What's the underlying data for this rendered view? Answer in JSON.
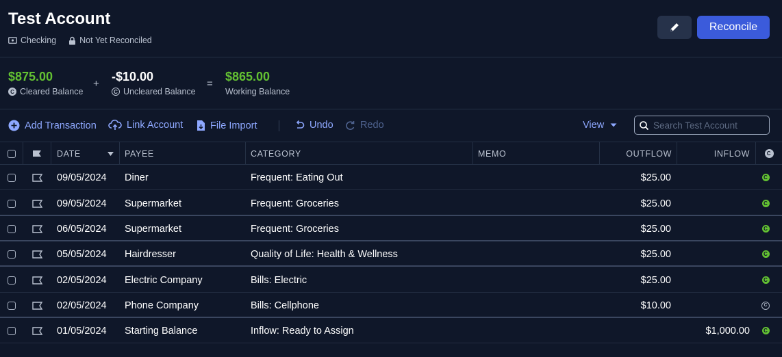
{
  "account": {
    "title": "Test Account",
    "type_label": "Checking",
    "reconcile_status": "Not Yet Reconciled",
    "reconcile_button": "Reconcile"
  },
  "balances": {
    "cleared": {
      "amount": "$875.00",
      "label": "Cleared Balance"
    },
    "plus": "+",
    "uncleared": {
      "amount": "-$10.00",
      "label": "Uncleared Balance"
    },
    "equals": "=",
    "working": {
      "amount": "$865.00",
      "label": "Working Balance"
    }
  },
  "toolbar": {
    "add_transaction": "Add Transaction",
    "link_account": "Link Account",
    "file_import": "File Import",
    "undo": "Undo",
    "redo": "Redo",
    "view": "View",
    "search_placeholder": "Search Test Account"
  },
  "columns": {
    "date": "DATE",
    "payee": "PAYEE",
    "category": "CATEGORY",
    "memo": "MEMO",
    "outflow": "OUTFLOW",
    "inflow": "INFLOW"
  },
  "transactions": [
    {
      "date": "09/05/2024",
      "payee": "Diner",
      "category": "Frequent: Eating Out",
      "memo": "",
      "outflow": "$25.00",
      "inflow": "",
      "cleared": true
    },
    {
      "date": "09/05/2024",
      "payee": "Supermarket",
      "category": "Frequent: Groceries",
      "memo": "",
      "outflow": "$25.00",
      "inflow": "",
      "cleared": true
    },
    {
      "date": "06/05/2024",
      "payee": "Supermarket",
      "category": "Frequent: Groceries",
      "memo": "",
      "outflow": "$25.00",
      "inflow": "",
      "cleared": true
    },
    {
      "date": "05/05/2024",
      "payee": "Hairdresser",
      "category": "Quality of Life: Health & Wellness",
      "memo": "",
      "outflow": "$25.00",
      "inflow": "",
      "cleared": true
    },
    {
      "date": "02/05/2024",
      "payee": "Electric Company",
      "category": "Bills: Electric",
      "memo": "",
      "outflow": "$25.00",
      "inflow": "",
      "cleared": true
    },
    {
      "date": "02/05/2024",
      "payee": "Phone Company",
      "category": "Bills: Cellphone",
      "memo": "",
      "outflow": "$10.00",
      "inflow": "",
      "cleared": false
    },
    {
      "date": "01/05/2024",
      "payee": "Starting Balance",
      "category": "Inflow: Ready to Assign",
      "memo": "",
      "outflow": "",
      "inflow": "$1,000.00",
      "cleared": true
    }
  ],
  "colors": {
    "background": "#0f1729",
    "accent": "#3b5bdb",
    "link": "#8ea8ff",
    "positive": "#63c132"
  }
}
